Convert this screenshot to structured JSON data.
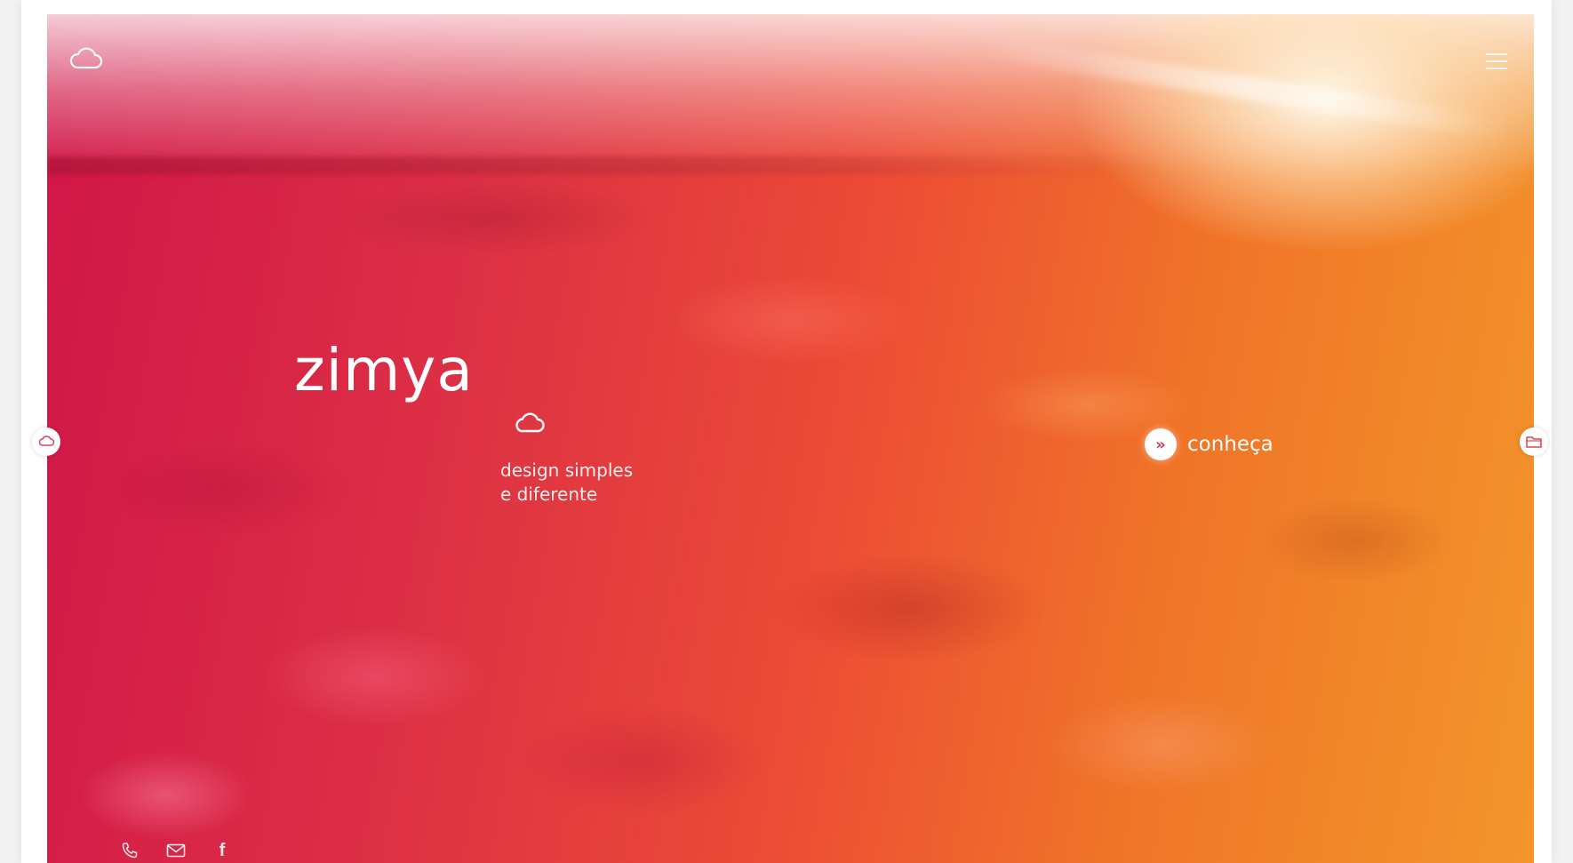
{
  "brand": {
    "name": "zimya",
    "tagline_line1": "design simples",
    "tagline_line2": "e diferente"
  },
  "cta": {
    "label": "conheça",
    "icon_glyph": "»",
    "icon": "double-chevron-right-icon"
  },
  "header": {
    "logo_icon": "cloud-icon",
    "menu_icon": "hamburger-menu-icon"
  },
  "sidebar": {
    "left_icon": "cloud-icon",
    "right_icon": "folder-icon"
  },
  "footer": {
    "icons": [
      "phone-icon",
      "mail-icon",
      "facebook-icon"
    ],
    "facebook_glyph": "f"
  },
  "colors": {
    "gradient_left": "#d01648",
    "gradient_mid": "#ec4a36",
    "gradient_right": "#f2962a",
    "accent": "#d63a57",
    "text": "#ffffff"
  }
}
